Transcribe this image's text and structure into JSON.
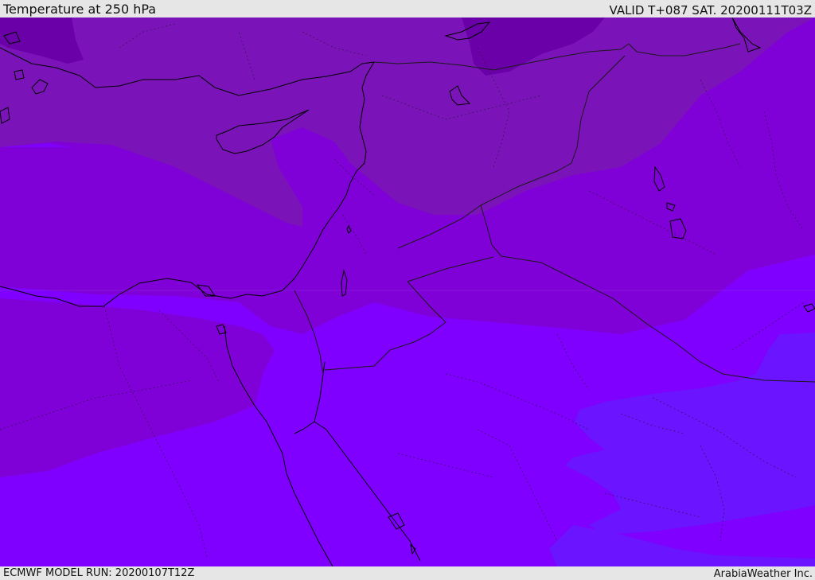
{
  "header": {
    "title": "Temperature at 250 hPa",
    "valid_time": "VALID T+087 SAT. 20200111T03Z"
  },
  "footer": {
    "model_run": "ECMWF MODEL RUN: 20200107T12Z",
    "credit": "ArabiaWeather Inc."
  },
  "map": {
    "field_colors": {
      "coldest": "#6a00a8",
      "cold": "#7a14b8",
      "cool": "#8000d8",
      "mild": "#7f00ff",
      "warm": "#6a14ff"
    },
    "line_colors": {
      "coast": "#000000",
      "border": "#222222"
    }
  }
}
